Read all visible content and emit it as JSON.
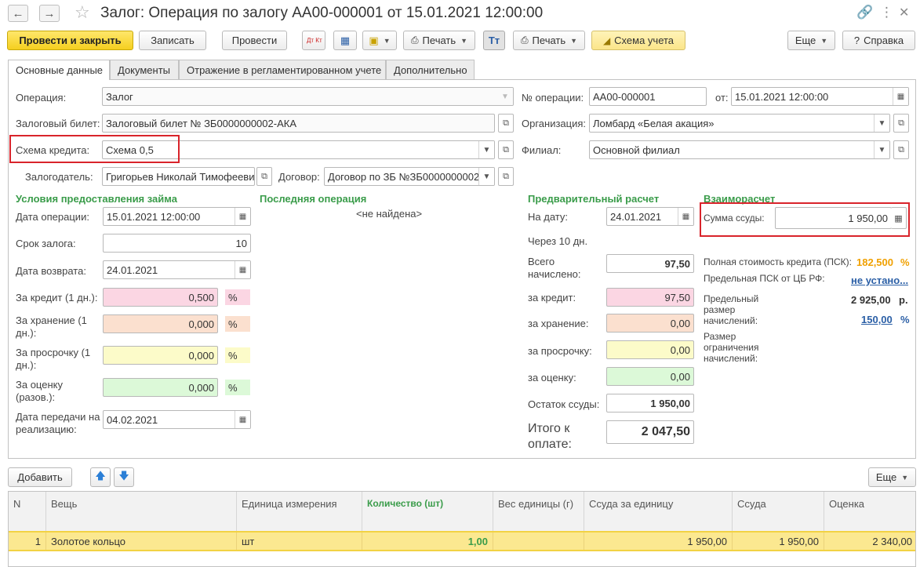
{
  "window": {
    "title": "Залог: Операция по залогу АА00-000001 от 15.01.2021 12:00:00"
  },
  "toolbar": {
    "post_close": "Провести и закрыть",
    "save": "Записать",
    "post": "Провести",
    "dt_kt": "Дт Кт",
    "print1": "Печать",
    "print2": "Печать",
    "scheme": "Схема учета",
    "more": "Еще",
    "help": "Справка"
  },
  "tabs": [
    "Основные данные",
    "Документы",
    "Отражение в регламентированном учете",
    "Дополнительно"
  ],
  "header": {
    "operation_label": "Операция:",
    "operation_value": "Залог",
    "ticket_label": "Залоговый билет:",
    "ticket_value": "Залоговый билет № ЗБ0000000002-АКА",
    "scheme_label": "Схема кредита:",
    "scheme_value": "Схема 0,5",
    "pledger_label": "Залогодатель:",
    "pledger_value": "Григорьев Николай Тимофеевич",
    "contract_label": "Договор:",
    "contract_value": "Договор по ЗБ №ЗБ0000000002-АКА",
    "opnum_label": "№ операции:",
    "opnum_value": "АА00-000001",
    "from_label": "от:",
    "from_value": "15.01.2021 12:00:00",
    "org_label": "Организация:",
    "org_value": "Ломбард «Белая акация»",
    "branch_label": "Филиал:",
    "branch_value": "Основной филиал"
  },
  "loan_terms": {
    "title": "Условия предоставления займа",
    "op_date_label": "Дата операции:",
    "op_date_value": "15.01.2021 12:00:00",
    "term_label": "Срок залога:",
    "term_value": "10",
    "return_label": "Дата возврата:",
    "return_value": "24.01.2021",
    "credit_label": "За кредит (1 дн.):",
    "credit_value": "0,500",
    "storage_label": "За хранение (1 дн.):",
    "storage_value": "0,000",
    "overdue_label": "За просрочку (1 дн.):",
    "overdue_value": "0,000",
    "appraisal_label": "За оценку (разов.):",
    "appraisal_value": "0,000",
    "percent": "%",
    "transfer_label": "Дата передачи на реализацию:",
    "transfer_value": "04.02.2021"
  },
  "last_operation": {
    "title": "Последняя операция",
    "value": "<не найдена>"
  },
  "preliminary": {
    "title": "Предварительный расчет",
    "date_label": "На дату:",
    "date_value": "24.01.2021",
    "after_text": "Через 10 дн.",
    "total_accrued_label": "Всего начислено:",
    "total_accrued_value": "97,50",
    "credit_label": "за кредит:",
    "credit_value": "97,50",
    "storage_label": "за хранение:",
    "storage_value": "0,00",
    "overdue_label": "за просрочку:",
    "overdue_value": "0,00",
    "appraisal_label": "за оценку:",
    "appraisal_value": "0,00",
    "balance_label": "Остаток ссуды:",
    "balance_value": "1 950,00",
    "total_label": "Итого к оплате:",
    "total_value": "2 047,50"
  },
  "settlement": {
    "title": "Взаиморасчет",
    "loan_label": "Сумма ссуды:",
    "loan_value": "1 950,00",
    "psk_label": "Полная стоимость кредита (ПСК):",
    "psk_value": "182,500",
    "psk_pct": "%",
    "cb_label": "Предельная ПСК от ЦБ РФ:",
    "cb_value": "не устано...",
    "limit_label": "Предельный размер начислений:",
    "limit_value": "2 925,00",
    "limit_unit": "р.",
    "limit_pct_value": "150,00",
    "limit_pct": "%",
    "restriction_label": "Размер ограничения начислений:"
  },
  "table_toolbar": {
    "add": "Добавить",
    "more": "Еще"
  },
  "table": {
    "headers": [
      "N",
      "Вещь",
      "Единица измерения",
      "Количество (шт)",
      "Вес единицы (г)",
      "Ссуда за единицу",
      "Ссуда",
      "Оценка"
    ],
    "rows": [
      [
        "1",
        "Золотое кольцо",
        "шт",
        "1,00",
        "",
        "1 950,00",
        "1 950,00",
        "2 340,00"
      ]
    ]
  },
  "colors": {
    "accent_yellow": "#f5cf1f",
    "section_green": "#3a9c4a",
    "highlight_red": "#d9242b",
    "link_blue": "#2b5fa6",
    "orange_value": "#f0a000"
  }
}
